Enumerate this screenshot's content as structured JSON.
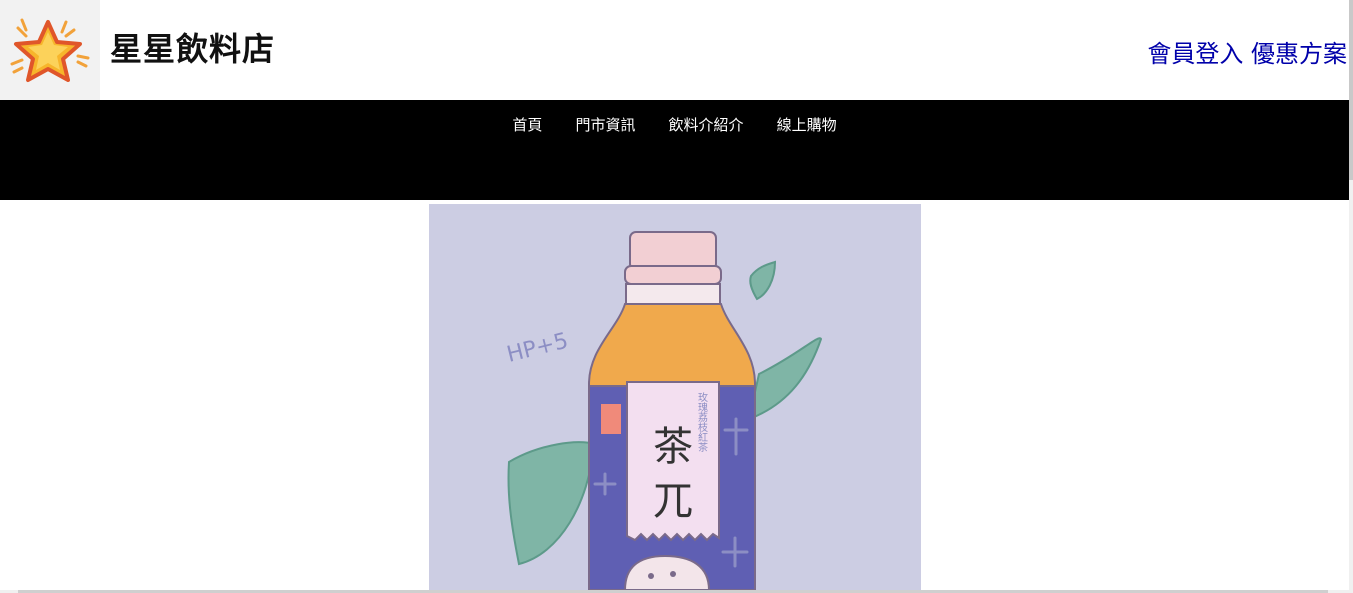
{
  "header": {
    "site_title": "星星飲料店",
    "login_link": "會員登入",
    "promo_link": "優惠方案",
    "logo_icon": "star-icon"
  },
  "nav": {
    "items": [
      {
        "label": "首頁"
      },
      {
        "label": "門市資訊"
      },
      {
        "label": "飲料介紹介"
      },
      {
        "label": "線上購物"
      }
    ]
  },
  "hero": {
    "hp_text": "HP+5",
    "label_big_1": "茶",
    "label_big_2": "兀",
    "label_small": "玫瑰荔枝紅茶"
  },
  "colors": {
    "nav_bg": "#000000",
    "link": "#0000aa",
    "hero_bg": "#cccde3"
  }
}
